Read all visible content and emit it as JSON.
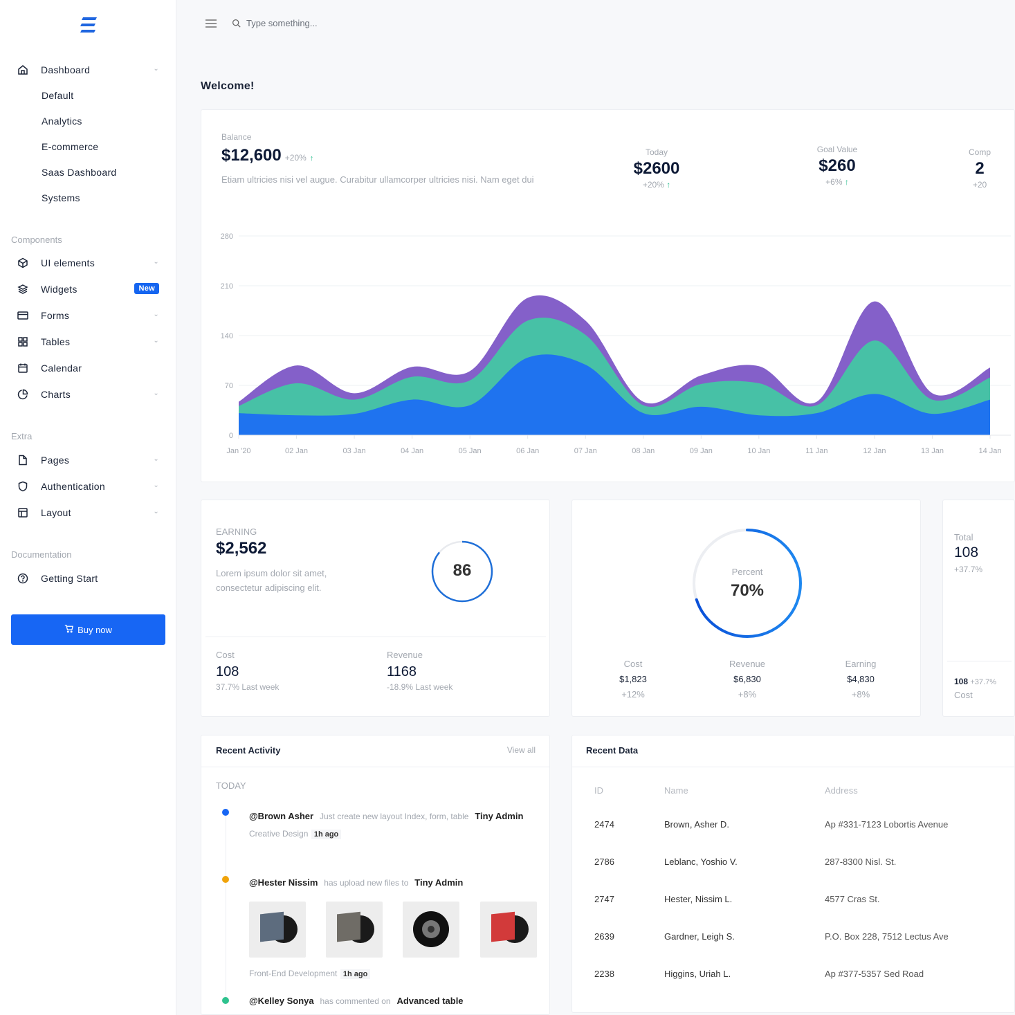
{
  "sidebar": {
    "dashboard": {
      "label": "Dashboard",
      "icon": "home-icon",
      "items": [
        "Default",
        "Analytics",
        "E-commerce",
        "Saas Dashboard",
        "Systems"
      ]
    },
    "components_title": "Components",
    "components": [
      {
        "label": "UI elements",
        "icon": "cube-icon"
      },
      {
        "label": "Widgets",
        "icon": "layers-icon",
        "badge": "New"
      },
      {
        "label": "Forms",
        "icon": "credit-card-icon"
      },
      {
        "label": "Tables",
        "icon": "grid-icon"
      },
      {
        "label": "Calendar",
        "icon": "calendar-icon"
      },
      {
        "label": "Charts",
        "icon": "pie-chart-icon"
      }
    ],
    "extra_title": "Extra",
    "extra": [
      {
        "label": "Pages",
        "icon": "file-icon"
      },
      {
        "label": "Authentication",
        "icon": "shield-icon"
      },
      {
        "label": "Layout",
        "icon": "layout-icon"
      }
    ],
    "docs_title": "Documentation",
    "docs": [
      {
        "label": "Getting Start",
        "icon": "help-circle-icon"
      }
    ],
    "buy_label": "Buy now"
  },
  "topbar": {
    "search_placeholder": "Type something..."
  },
  "welcome": "Welcome!",
  "balance": {
    "label": "Balance",
    "value": "$12,600",
    "change": "+20%",
    "description": "Etiam ultricies nisi vel augue. Curabitur ullamcorper ultricies nisi. Nam eget dui",
    "stats": [
      {
        "label": "Today",
        "value": "$2600",
        "change": "+20%"
      },
      {
        "label": "Goal Value",
        "value": "$260",
        "change": "+6%"
      },
      {
        "label": "Comp",
        "value": "2",
        "change": "+20"
      }
    ]
  },
  "chart_data": {
    "type": "area",
    "stacked": true,
    "categories": [
      "Jan '20",
      "02 Jan",
      "03 Jan",
      "04 Jan",
      "05 Jan",
      "06 Jan",
      "07 Jan",
      "08 Jan",
      "09 Jan",
      "10 Jan",
      "11 Jan",
      "12 Jan",
      "13 Jan",
      "14 Jan"
    ],
    "series": [
      {
        "values": [
          31,
          28,
          30,
          50,
          42,
          109,
          99,
          31,
          40,
          28,
          31,
          58,
          30,
          50
        ],
        "color": "#1f73ef"
      },
      {
        "values": [
          10,
          45,
          20,
          32,
          35,
          52,
          42,
          11,
          32,
          45,
          11,
          75,
          20,
          31
        ],
        "color": "#47c1a6"
      },
      {
        "values": [
          6,
          25,
          9,
          14,
          13,
          32,
          20,
          5,
          12,
          24,
          5,
          55,
          9,
          14
        ],
        "color": "#8460c9"
      }
    ],
    "yticks": [
      0,
      70,
      140,
      210,
      280
    ],
    "ylim": [
      0,
      280
    ],
    "grid": true
  },
  "earning": {
    "label": "EARNING",
    "value": "$2,562",
    "description_1": "Lorem ipsum dolor sit amet,",
    "description_2": "consectetur adipiscing elit.",
    "gauge_value": "86",
    "gauge_percent": 86,
    "cost": {
      "label": "Cost",
      "value": "108",
      "change": "37.7% Last week"
    },
    "revenue": {
      "label": "Revenue",
      "value": "1168",
      "change": "-18.9% Last week"
    }
  },
  "percent_card": {
    "label": "Percent",
    "value": "70%",
    "percent": 70,
    "stats": [
      {
        "label": "Cost",
        "value": "$1,823",
        "change": "+12%"
      },
      {
        "label": "Revenue",
        "value": "$6,830",
        "change": "+8%"
      },
      {
        "label": "Earning",
        "value": "$4,830",
        "change": "+8%"
      }
    ]
  },
  "total_card": {
    "label": "Total",
    "value": "108",
    "change": "+37.7%",
    "footer_value": "108",
    "footer_change": "+37.7%",
    "footer_label": "Cost"
  },
  "activity": {
    "title": "Recent Activity",
    "view_all": "View all",
    "day": "TODAY",
    "items": [
      {
        "user": "@Brown Asher",
        "text": "Just create new layout Index, form, table",
        "target": "Tiny Admin",
        "category": "Creative Design",
        "time": "1h ago",
        "color": "#1766f4"
      },
      {
        "user": "@Hester Nissim",
        "text": "has upload new files to",
        "target": "Tiny Admin",
        "category": "Front-End Development",
        "time": "1h ago",
        "color": "#f0a30a"
      },
      {
        "user": "@Kelley Sonya",
        "text": "has commented on",
        "target": "Advanced table",
        "color": "#2ec28e"
      }
    ]
  },
  "recent_data": {
    "title": "Recent Data",
    "columns": [
      "ID",
      "Name",
      "Address"
    ],
    "rows": [
      [
        "2474",
        "Brown, Asher D.",
        "Ap #331-7123 Lobortis Avenue"
      ],
      [
        "2786",
        "Leblanc, Yoshio V.",
        "287-8300 Nisl. St."
      ],
      [
        "2747",
        "Hester, Nissim L.",
        "4577 Cras St."
      ],
      [
        "2639",
        "Gardner, Leigh S.",
        "P.O. Box 228, 7512 Lectus Ave"
      ],
      [
        "2238",
        "Higgins, Uriah L.",
        "Ap #377-5357 Sed Road"
      ]
    ]
  }
}
